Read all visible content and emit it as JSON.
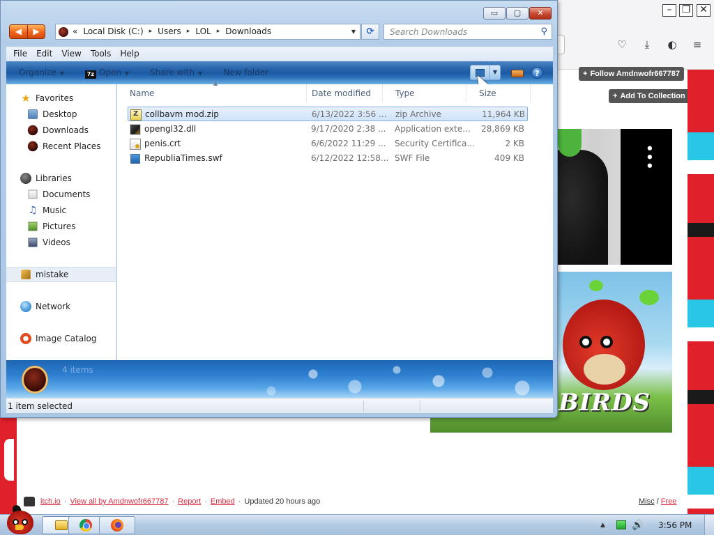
{
  "background_page": {
    "follow_label": "Follow Amdnwofr667787",
    "collection_label": "Add To Collection",
    "banner_text": "BIRDS",
    "footer": {
      "site": "itch.io",
      "view_all": "View all by Amdnwofr667787",
      "report": "Report",
      "embed": "Embed",
      "updated": "Updated 20 hours ago",
      "misc": "Misc",
      "free": "Free",
      "separator": "·"
    }
  },
  "explorer": {
    "title_buttons": {
      "minimize": "▭",
      "maximize": "▢",
      "close": "✕"
    },
    "nav_arrows": {
      "back": "◀",
      "forward": "▶"
    },
    "address": {
      "prefix": "«",
      "segments": [
        "Local Disk (C:)",
        "Users",
        "LOL",
        "Downloads"
      ],
      "separator": "▸",
      "dropdown": "▼"
    },
    "refresh_glyph": "⟳",
    "search": {
      "placeholder": "Search Downloads",
      "icon": "search-icon"
    },
    "menu": [
      "File",
      "Edit",
      "View",
      "Tools",
      "Help"
    ],
    "commands": {
      "organize": "Organize",
      "open": "Open",
      "open_badge": "7z",
      "share_with": "Share with",
      "new_folder": "New folder",
      "caret": "▼",
      "help": "?"
    },
    "nav_pane": {
      "favorites": "Favorites",
      "desktop": "Desktop",
      "downloads": "Downloads",
      "recent_places": "Recent Places",
      "libraries": "Libraries",
      "documents": "Documents",
      "music": "Music",
      "pictures": "Pictures",
      "videos": "Videos",
      "computer": "mistake",
      "network": "Network",
      "image_catalog": "Image Catalog",
      "star_glyph": "★",
      "music_glyph": "♫"
    },
    "columns": {
      "name": "Name",
      "date": "Date modified",
      "type": "Type",
      "size": "Size",
      "sort_caret": "▲"
    },
    "files": [
      {
        "name": "collbavm mod.zip",
        "date": "6/13/2022 3:56 ...",
        "type": "zip Archive",
        "size": "11,964 KB"
      },
      {
        "name": "opengl32.dll",
        "date": "9/17/2020 2:38 ...",
        "type": "Application exte...",
        "size": "28,869 KB"
      },
      {
        "name": "penis.crt",
        "date": "6/6/2022 11:29 ...",
        "type": "Security Certifica...",
        "size": "2 KB"
      },
      {
        "name": "RepubliaTimes.swf",
        "date": "6/12/2022 12:58...",
        "type": "SWF File",
        "size": "409 KB"
      }
    ],
    "details_text": "4 items",
    "status_text": "1 item selected"
  },
  "taskbar": {
    "clock": "3:56 PM",
    "tray_arrow": "▲",
    "volume_glyph": "🔊"
  },
  "colors": {
    "accent_blue": "#2a66ad",
    "selection": "#cfe3f8",
    "itch_red": "#da2c43",
    "nav_orange": "#f0621b"
  }
}
